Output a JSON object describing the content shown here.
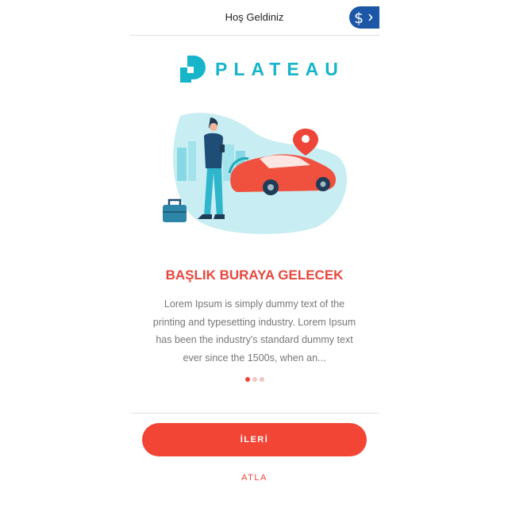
{
  "header": {
    "title": "Hoş Geldiniz",
    "currency_button_icon": "lira-currency-icon",
    "chevron_icon": "chevron-right-icon"
  },
  "brand": {
    "logo_icon": "plateau-logo-icon",
    "name": "PLATEAU",
    "color": "#17b5c9"
  },
  "slide": {
    "illustration": "man-with-phone-and-red-car-illustration",
    "title": "BAŞLIK BURAYA GELECEK",
    "description": "Lorem Ipsum is simply dummy text of the printing and typesetting industry. Lorem Ipsum has been the industry's standard dummy text ever since the 1500s, when an...",
    "page_index": 1,
    "page_count": 3
  },
  "actions": {
    "next_label": "İLERİ",
    "skip_label": "ATLA"
  },
  "colors": {
    "accent": "#f34536",
    "currency_button": "#1c56a6"
  }
}
